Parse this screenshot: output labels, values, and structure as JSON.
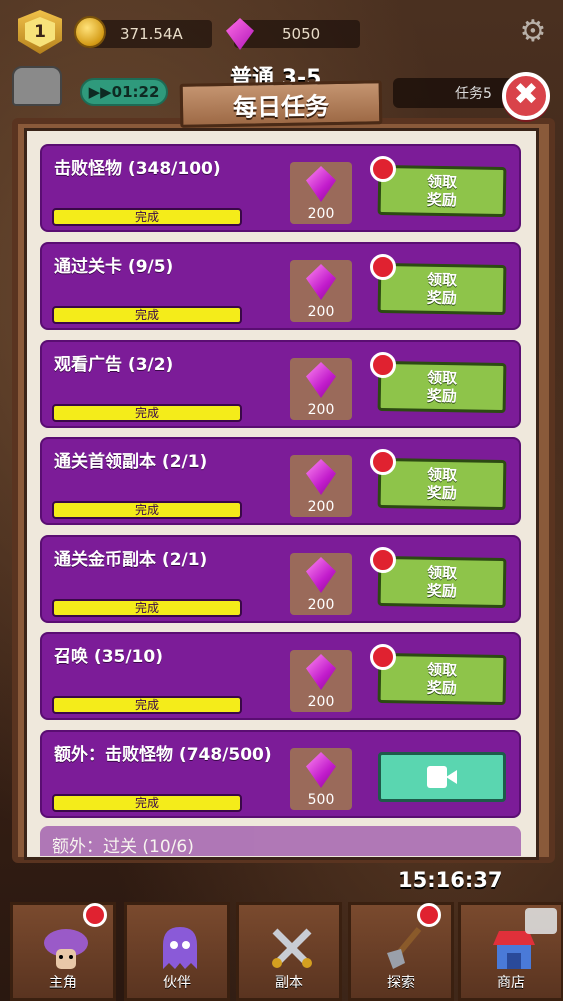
{
  "topbar": {
    "level": "1",
    "coins": "371.54A",
    "gems": "5050"
  },
  "behind": {
    "timer": "▶▶01:22",
    "stage_title": "普通 3-5",
    "task_pill": "任务5"
  },
  "modal": {
    "title": "每日任务",
    "close_label": "✖"
  },
  "tasks": [
    {
      "name": "击败怪物 (348/100)",
      "status": "完成",
      "reward": "200",
      "claim_label": "领取\n奖励"
    },
    {
      "name": "通过关卡 (9/5)",
      "status": "完成",
      "reward": "200",
      "claim_label": "领取\n奖励"
    },
    {
      "name": "观看广告 (3/2)",
      "status": "完成",
      "reward": "200",
      "claim_label": "领取\n奖励"
    },
    {
      "name": "通关首领副本 (2/1)",
      "status": "完成",
      "reward": "200",
      "claim_label": "领取\n奖励"
    },
    {
      "name": "通关金币副本 (2/1)",
      "status": "完成",
      "reward": "200",
      "claim_label": "领取\n奖励"
    },
    {
      "name": "召唤 (35/10)",
      "status": "完成",
      "reward": "200",
      "claim_label": "领取\n奖励"
    },
    {
      "name": "额外：击败怪物 (748/500)",
      "status": "完成",
      "reward": "500",
      "claim_label": ""
    }
  ],
  "partial_task": "额外：过关 (10/6)",
  "clock": "15:16:37",
  "nav": [
    {
      "label": "主角"
    },
    {
      "label": "伙伴"
    },
    {
      "label": "副本"
    },
    {
      "label": "探索"
    },
    {
      "label": "商店"
    }
  ]
}
